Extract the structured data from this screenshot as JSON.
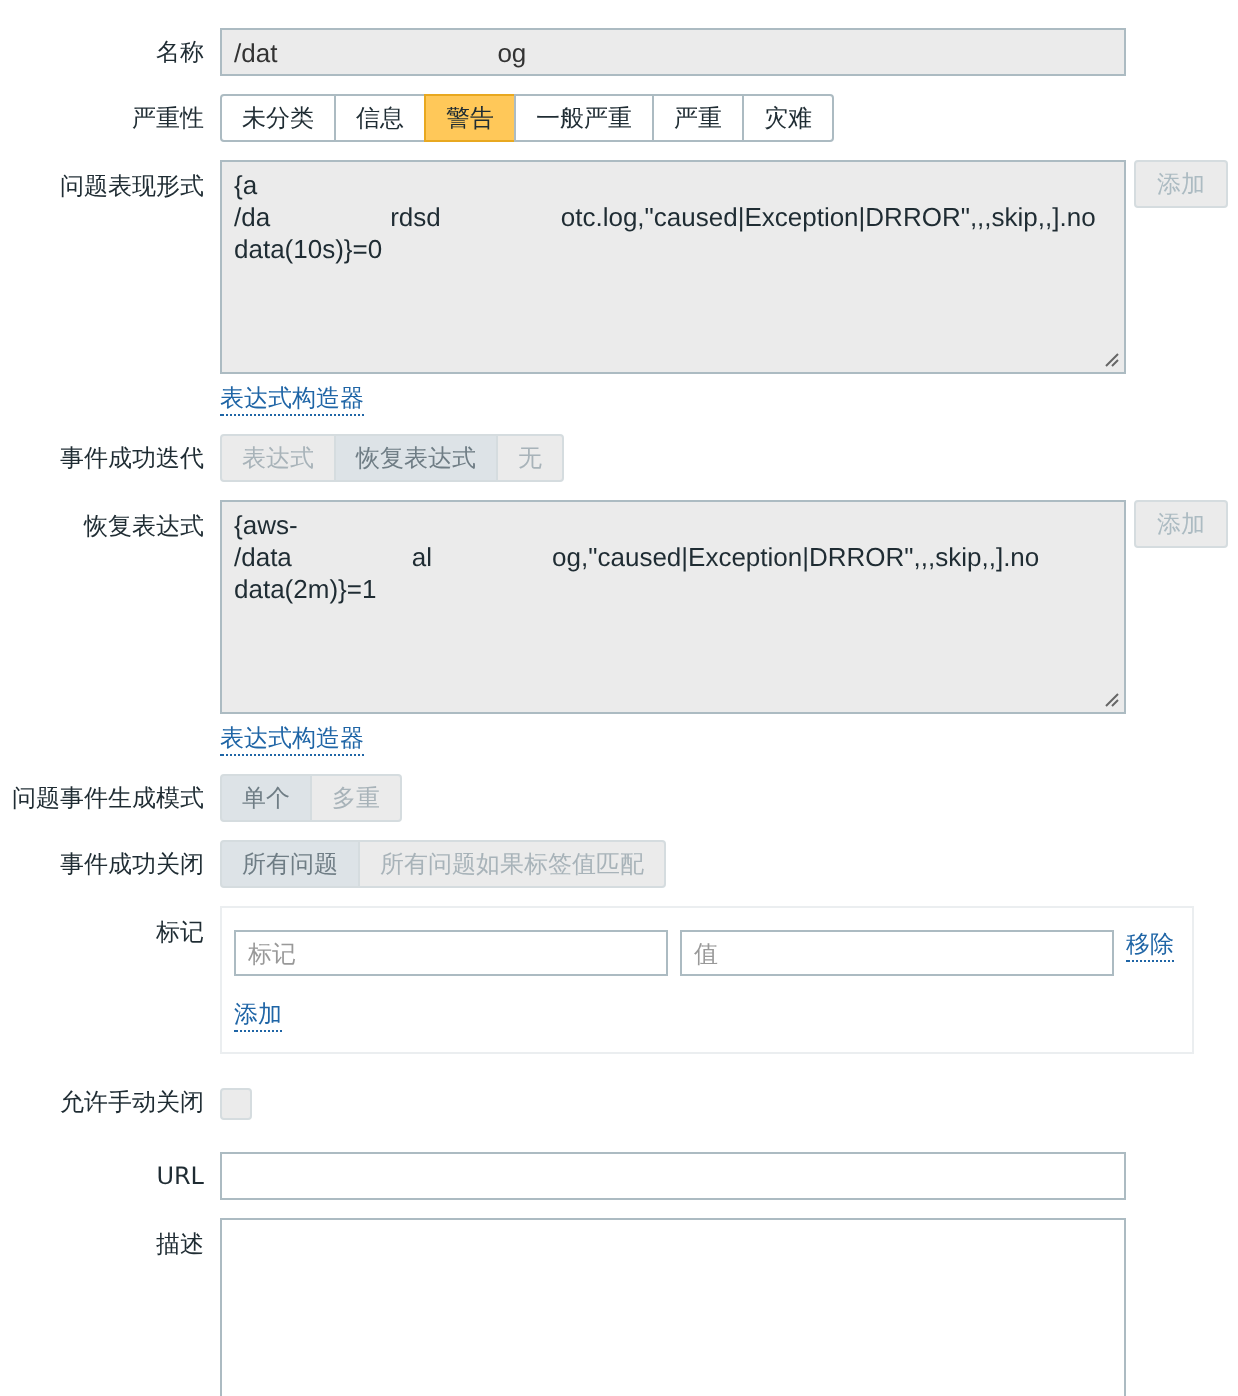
{
  "name": {
    "label": "名称",
    "value_parts": [
      "/dat",
      "og"
    ],
    "disabled": true
  },
  "severity": {
    "label": "严重性",
    "options": [
      {
        "label": "未分类",
        "selected": false
      },
      {
        "label": "信息",
        "selected": false
      },
      {
        "label": "警告",
        "selected": true
      },
      {
        "label": "一般严重",
        "selected": false
      },
      {
        "label": "严重",
        "selected": false
      },
      {
        "label": "灾难",
        "selected": false
      }
    ]
  },
  "problem_expression": {
    "label": "问题表现形式",
    "lines": [
      [
        "{a"
      ],
      [
        "/da",
        "rdsd",
        "otc.log,\"caused|Exception|DRROR\",,,skip,,].no"
      ],
      [
        "data(10s)}=0"
      ]
    ],
    "disabled": true,
    "add_button": {
      "label": "添加",
      "disabled": true
    },
    "builder_link": "表达式构造器"
  },
  "ok_event_generation": {
    "label": "事件成功迭代",
    "disabled": true,
    "options": [
      {
        "label": "表达式",
        "selected": false
      },
      {
        "label": "恢复表达式",
        "selected": true
      },
      {
        "label": "无",
        "selected": false
      }
    ]
  },
  "recovery_expression": {
    "label": "恢复表达式",
    "lines": [
      [
        "{aws-"
      ],
      [
        "/data",
        "al",
        "og,\"caused|Exception|DRROR\",,,skip,,].no"
      ],
      [
        "data(2m)}=1"
      ]
    ],
    "disabled": true,
    "add_button": {
      "label": "添加",
      "disabled": true
    },
    "builder_link": "表达式构造器"
  },
  "problem_event_mode": {
    "label": "问题事件生成模式",
    "disabled": true,
    "options": [
      {
        "label": "单个",
        "selected": true
      },
      {
        "label": "多重",
        "selected": false
      }
    ]
  },
  "ok_event_closes": {
    "label": "事件成功关闭",
    "disabled": true,
    "options": [
      {
        "label": "所有问题",
        "selected": true
      },
      {
        "label": "所有问题如果标签值匹配",
        "selected": false
      }
    ]
  },
  "tags": {
    "label": "标记",
    "rows": [
      {
        "tag_placeholder": "标记",
        "value_placeholder": "值",
        "remove_link": "移除"
      }
    ],
    "add_link": "添加"
  },
  "allow_manual_close": {
    "label": "允许手动关闭",
    "checked": false,
    "disabled": true
  },
  "url": {
    "label": "URL"
  },
  "description": {
    "label": "描述"
  }
}
